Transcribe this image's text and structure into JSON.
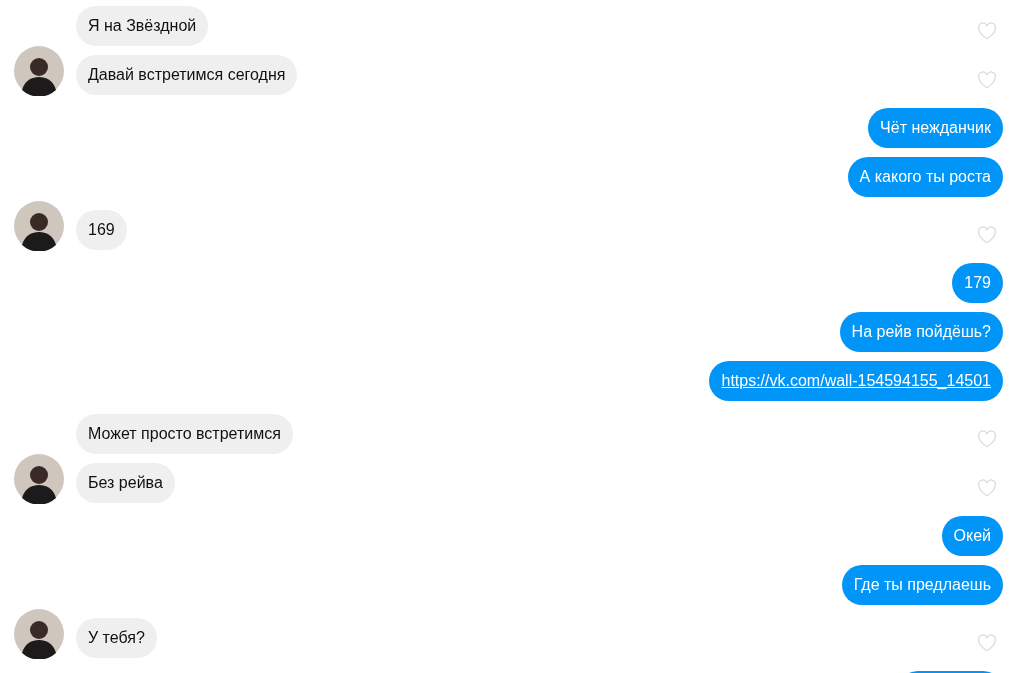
{
  "messages": [
    {
      "kind": "incoming",
      "avatar": false,
      "text": "Я на Звёздной"
    },
    {
      "kind": "incoming",
      "avatar": true,
      "text": "Давай встретимся сегодня"
    },
    {
      "kind": "outgoing",
      "text": "Чёт нежданчик"
    },
    {
      "kind": "outgoing",
      "text": "А какого ты роста"
    },
    {
      "kind": "incoming",
      "avatar": true,
      "text": "169"
    },
    {
      "kind": "outgoing",
      "text": "179"
    },
    {
      "kind": "outgoing",
      "text": "На рейв пойдёшь?"
    },
    {
      "kind": "link",
      "text": "https://vk.com/wall-154594155_14501"
    },
    {
      "kind": "incoming",
      "avatar": false,
      "text": "Может просто встретимся"
    },
    {
      "kind": "incoming",
      "avatar": true,
      "text": "Без рейва"
    },
    {
      "kind": "outgoing",
      "text": "Окей"
    },
    {
      "kind": "outgoing",
      "text": "Где ты предлаешь"
    },
    {
      "kind": "incoming",
      "avatar": true,
      "text": "У тебя?"
    },
    {
      "kind": "cut"
    }
  ]
}
